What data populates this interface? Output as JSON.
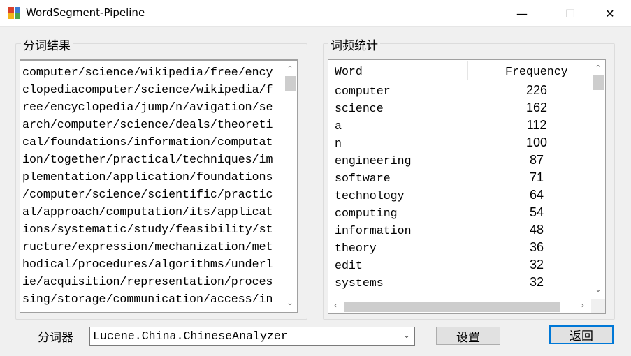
{
  "window": {
    "title": "WordSegment-Pipeline",
    "minimize": "—",
    "maximize": "☐",
    "close": "✕"
  },
  "segment_group": {
    "label": "分词结果",
    "lines": [
      "computer/science/wikipedia/free/ency",
      "clopediacomputer/science/wikipedia/f",
      "ree/encyclopedia/jump/n/avigation/se",
      "arch/computer/science/deals/theoreti",
      "cal/foundations/information/computat",
      "ion/together/practical/techniques/im",
      "plementation/application/foundations",
      "/computer/science/scientific/practic",
      "al/approach/computation/its/applicat",
      "ions/systematic/study/feasibility/st",
      "ructure/expression/mechanization/met",
      "hodical/procedures/algorithms/underl",
      "ie/acquisition/representation/proces",
      "sing/storage/communication/access/in"
    ]
  },
  "freq_group": {
    "label": "词频统计",
    "columns": [
      "Word",
      "Frequency"
    ],
    "rows": [
      {
        "word": "computer",
        "freq": "226"
      },
      {
        "word": "science",
        "freq": "162"
      },
      {
        "word": "a",
        "freq": "112"
      },
      {
        "word": "n",
        "freq": "100"
      },
      {
        "word": "engineering",
        "freq": "87"
      },
      {
        "word": "software",
        "freq": "71"
      },
      {
        "word": "technology",
        "freq": "64"
      },
      {
        "word": "computing",
        "freq": "54"
      },
      {
        "word": "information",
        "freq": "48"
      },
      {
        "word": "theory",
        "freq": "36"
      },
      {
        "word": "edit",
        "freq": "32"
      },
      {
        "word": "systems",
        "freq": "32"
      }
    ]
  },
  "bottom": {
    "segmenter_label": "分词器",
    "segmenter_value": "Lucene.China.ChineseAnalyzer",
    "settings_button": "设置",
    "back_button": "返回"
  },
  "icons": {
    "up": "chevron-up-icon",
    "down": "chevron-down-icon",
    "left": "chevron-left-icon",
    "right": "chevron-right-icon"
  },
  "colors": {
    "accent": "#0078d7",
    "window_bg": "#f0f0f0"
  }
}
